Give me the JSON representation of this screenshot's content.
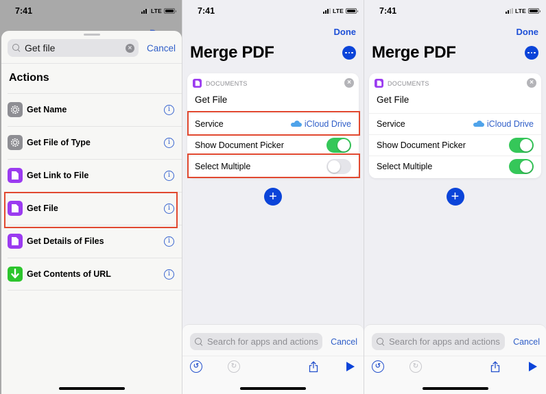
{
  "status_bar": {
    "time": "7:41",
    "network": "LTE"
  },
  "panel1": {
    "background_done_label": "Done",
    "search": {
      "value": "Get file",
      "cancel_label": "Cancel"
    },
    "section_heading": "Actions",
    "actions": [
      {
        "label": "Get Name",
        "icon": "gear-icon",
        "info": "i"
      },
      {
        "label": "Get File of Type",
        "icon": "gear-icon",
        "info": "i"
      },
      {
        "label": "Get Link to File",
        "icon": "document-icon",
        "info": "i"
      },
      {
        "label": "Get File",
        "icon": "document-icon",
        "info": "i",
        "highlighted": true
      },
      {
        "label": "Get Details of Files",
        "icon": "document-icon",
        "info": "i"
      },
      {
        "label": "Get Contents of URL",
        "icon": "download-icon",
        "info": "i"
      }
    ]
  },
  "editor": {
    "done_label": "Done",
    "title": "Merge PDF",
    "card": {
      "category": "DOCUMENTS",
      "title": "Get File",
      "service_label": "Service",
      "service_value": "iCloud Drive",
      "show_picker_label": "Show Document Picker",
      "select_multiple_label": "Select Multiple"
    },
    "add_label": "+",
    "bottom_search": {
      "placeholder": "Search for apps and actions",
      "cancel_label": "Cancel"
    }
  },
  "panel2": {
    "show_picker_on": true,
    "select_multiple_on": false
  },
  "panel3": {
    "show_picker_on": true,
    "select_multiple_on": true
  },
  "colors": {
    "accent_blue": "#0b44d9",
    "link_blue": "#2f5ec8",
    "toggle_green": "#35c759",
    "documents_purple": "#9b3bf0",
    "highlight_red": "#e1482f"
  }
}
